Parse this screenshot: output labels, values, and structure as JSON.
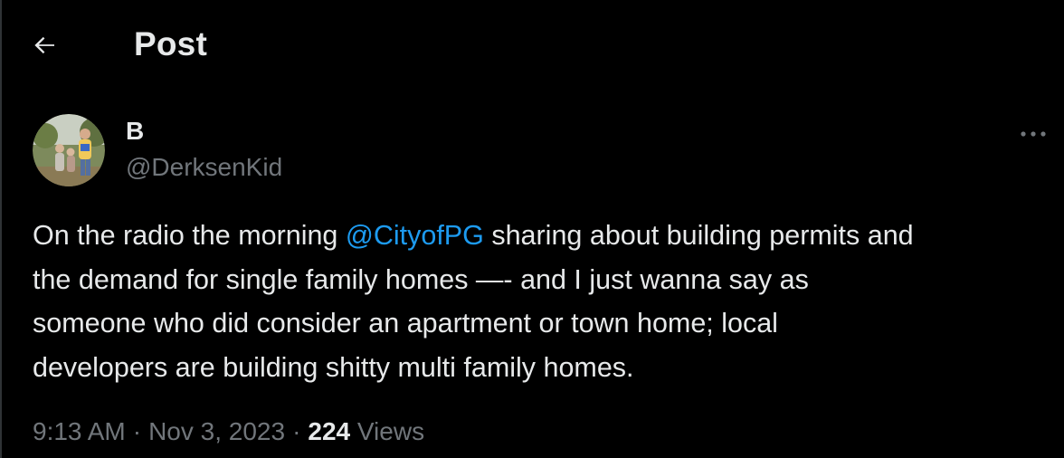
{
  "header": {
    "back_icon": "arrow-left-icon",
    "title": "Post"
  },
  "author": {
    "display_name": "B",
    "handle": "@DerksenKid",
    "avatar_icon": "avatar-photo"
  },
  "more_icon": "more-horizontal-icon",
  "tweet": {
    "line1_before": "On the radio the morning ",
    "mention": "@CityofPG",
    "line1_after": " sharing about building permits and",
    "line2": "the demand for single family homes —- and I just wanna say as",
    "line3": "someone who did consider an apartment or town home; local",
    "line4": "developers are building shitty multi family homes."
  },
  "meta": {
    "time": "9:13 AM",
    "separator": "·",
    "date": "Nov 3, 2023",
    "views_count": "224",
    "views_label": "Views"
  },
  "colors": {
    "background": "#000000",
    "text_primary": "#e7e9ea",
    "text_secondary": "#71767b",
    "accent": "#1d9bf0"
  }
}
